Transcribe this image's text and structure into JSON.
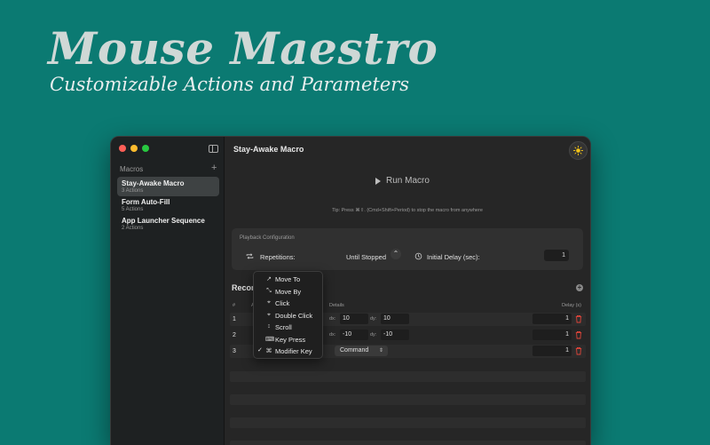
{
  "hero": {
    "title": "Mouse Maestro",
    "subtitle": "Customizable Actions and Parameters"
  },
  "sidebar": {
    "section_label": "Macros",
    "add_label": "+",
    "items": [
      {
        "name": "Stay-Awake Macro",
        "count": "3 Actions",
        "selected": true
      },
      {
        "name": "Form Auto-Fill",
        "count": "5 Actions",
        "selected": false
      },
      {
        "name": "App Launcher Sequence",
        "count": "2 Actions",
        "selected": false
      }
    ]
  },
  "main": {
    "title": "Stay-Awake Macro",
    "run_label": "Run Macro",
    "tip": "Tip: Press ⌘⇧. (Cmd+Shift+Period) to stop the macro from anywhere"
  },
  "playback": {
    "title": "Playback Configuration",
    "repetitions_label": "Repetitions:",
    "repetitions_value": "Until Stopped",
    "stepper_glyph": "⌃",
    "initial_delay_label": "Initial Delay (sec):",
    "initial_delay_value": "1"
  },
  "recorded": {
    "title": "Recorded Actions",
    "title_visible": "Recor",
    "add_label": "+",
    "headers": {
      "num": "#",
      "action": "A",
      "details": "Details",
      "delay": "Delay (s)"
    },
    "rows": [
      {
        "num": "1",
        "dx_label": "dx:",
        "dx": "10",
        "dy_label": "dy:",
        "dy": "10",
        "delay": "1"
      },
      {
        "num": "2",
        "dx_label": "dx:",
        "dx": "-10",
        "dy_label": "dy:",
        "dy": "-10",
        "delay": "1"
      },
      {
        "num": "3",
        "key": "Command",
        "delay": "1"
      }
    ]
  },
  "action_menu": {
    "items": [
      {
        "label": "Move To",
        "icon": "↗",
        "checked": false
      },
      {
        "label": "Move By",
        "icon": "⤡",
        "checked": false
      },
      {
        "label": "Click",
        "icon": "⌖",
        "checked": false
      },
      {
        "label": "Double Click",
        "icon": "⌖",
        "checked": false
      },
      {
        "label": "Scroll",
        "icon": "↕",
        "checked": false
      },
      {
        "label": "Key Press",
        "icon": "⌨",
        "checked": false
      },
      {
        "label": "Modifier Key",
        "icon": "⌘",
        "checked": true
      }
    ],
    "check_glyph": "✓"
  },
  "colors": {
    "background": "#0b7a72",
    "window": "#242424",
    "sidebar": "#1e2122",
    "accent_sun": "#f5c518",
    "delete_red": "#e0453a"
  }
}
